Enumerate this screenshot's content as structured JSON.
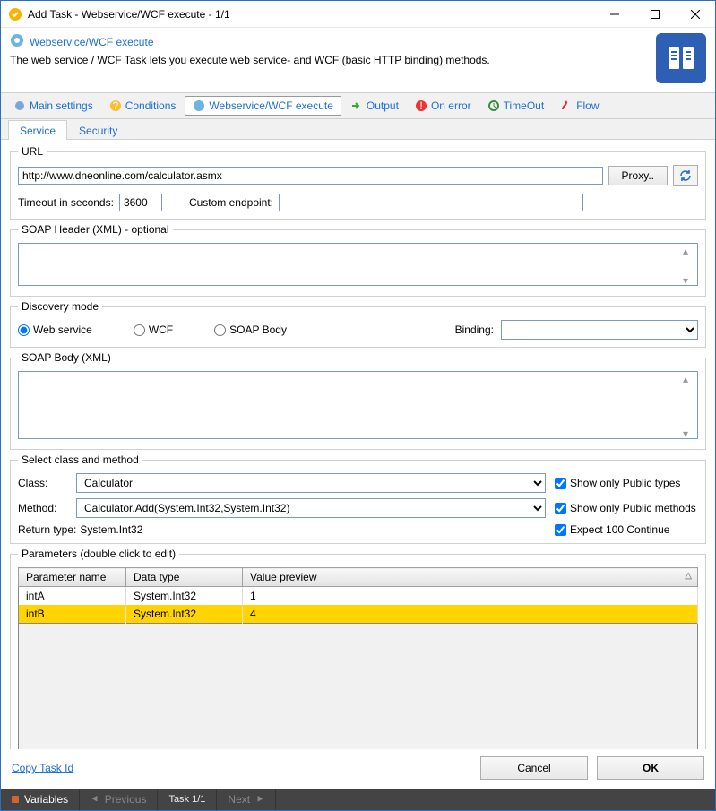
{
  "window": {
    "title": "Add Task - Webservice/WCF execute - 1/1"
  },
  "header": {
    "title": "Webservice/WCF execute",
    "desc": "The web service / WCF Task lets you execute web service- and WCF (basic HTTP binding) methods."
  },
  "maintabs": {
    "items": [
      {
        "label": "Main settings",
        "icon": "settings"
      },
      {
        "label": "Conditions",
        "icon": "question"
      },
      {
        "label": "Webservice/WCF execute",
        "icon": "wcf",
        "active": true
      },
      {
        "label": "Output",
        "icon": "output"
      },
      {
        "label": "On error",
        "icon": "error"
      },
      {
        "label": "TimeOut",
        "icon": "clock"
      },
      {
        "label": "Flow",
        "icon": "flow"
      }
    ]
  },
  "subtabs": {
    "items": [
      "Service",
      "Security"
    ],
    "active": 0
  },
  "url": {
    "legend": "URL",
    "value": "http://www.dneonline.com/calculator.asmx",
    "proxy_label": "Proxy..",
    "timeout_label": "Timeout in seconds:",
    "timeout_value": "3600",
    "endpoint_label": "Custom endpoint:",
    "endpoint_value": ""
  },
  "soap_header": {
    "legend": "SOAP Header (XML) - optional",
    "value": ""
  },
  "discovery": {
    "legend": "Discovery mode",
    "options": [
      "Web service",
      "WCF",
      "SOAP Body"
    ],
    "selected": 0,
    "binding_label": "Binding:",
    "binding_value": ""
  },
  "soap_body": {
    "legend": "SOAP Body (XML)",
    "value": ""
  },
  "select_cm": {
    "legend": "Select class and method",
    "class_label": "Class:",
    "class_value": "Calculator",
    "method_label": "Method:",
    "method_value": "Calculator.Add(System.Int32,System.Int32)",
    "return_label": "Return type:",
    "return_value": "System.Int32",
    "chk_public_types": "Show only Public types",
    "chk_public_methods": "Show only Public methods",
    "chk_expect": "Expect 100 Continue"
  },
  "params": {
    "legend": "Parameters (double click to edit)",
    "cols": [
      "Parameter name",
      "Data type",
      "Value preview"
    ],
    "rows": [
      {
        "name": "intA",
        "type": "System.Int32",
        "value": "1",
        "sel": false
      },
      {
        "name": "intB",
        "type": "System.Int32",
        "value": "4",
        "sel": true
      }
    ]
  },
  "footer": {
    "copy": "Copy Task Id",
    "cancel": "Cancel",
    "ok": "OK"
  },
  "status": {
    "variables": "Variables",
    "prev": "Previous",
    "task": "Task 1/1",
    "next": "Next"
  }
}
